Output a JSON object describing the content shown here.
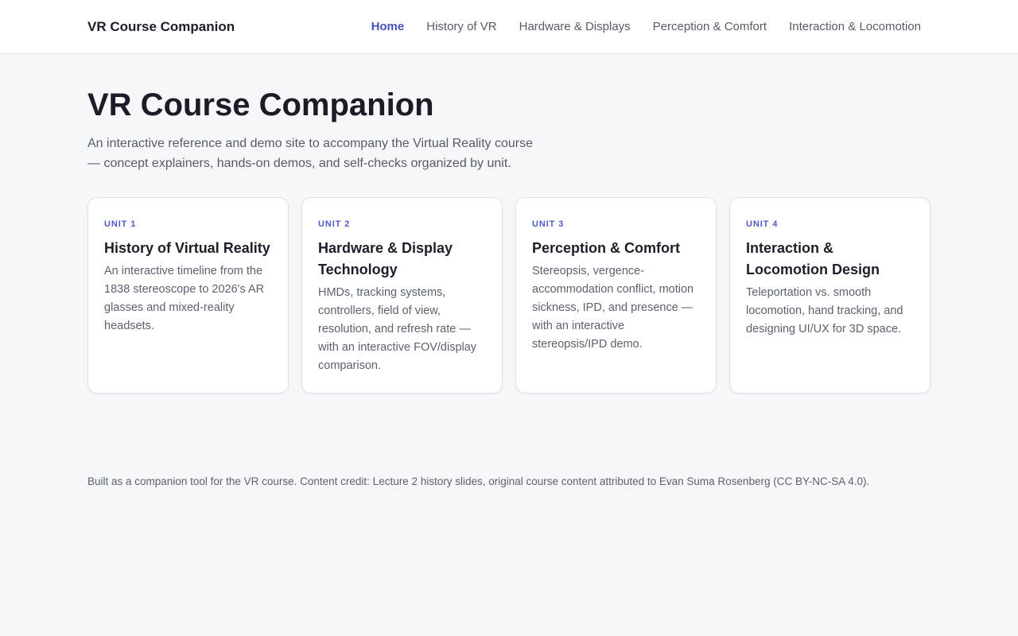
{
  "header": {
    "brand": "VR Course Companion",
    "nav": [
      {
        "label": "Home",
        "active": true
      },
      {
        "label": "History of VR",
        "active": false
      },
      {
        "label": "Hardware & Displays",
        "active": false
      },
      {
        "label": "Perception & Comfort",
        "active": false
      },
      {
        "label": "Interaction & Locomotion",
        "active": false
      }
    ]
  },
  "main": {
    "title": "VR Course Companion",
    "intro": "An interactive reference and demo site to accompany the Virtual Reality course — concept explainers, hands-on demos, and self-checks organized by unit.",
    "cards": [
      {
        "unit": "UNIT 1",
        "title": "History of Virtual Reality",
        "description": "An interactive timeline from the 1838 stereoscope to 2026's AR glasses and mixed-reality headsets."
      },
      {
        "unit": "UNIT 2",
        "title": "Hardware & Display Technology",
        "description": "HMDs, tracking systems, controllers, field of view, resolution, and refresh rate — with an interactive FOV/display comparison."
      },
      {
        "unit": "UNIT 3",
        "title": "Perception & Comfort",
        "description": "Stereopsis, vergence-accommodation conflict, motion sickness, IPD, and presence — with an interactive stereopsis/IPD demo."
      },
      {
        "unit": "UNIT 4",
        "title": "Interaction & Locomotion Design",
        "description": "Teleportation vs. smooth locomotion, hand tracking, and designing UI/UX for 3D space."
      }
    ]
  },
  "footer": {
    "text": "Built as a companion tool for the VR course. Content credit: Lecture 2 history slides, original course content attributed to Evan Suma Rosenberg (CC BY-NC-SA 4.0)."
  },
  "colors": {
    "accent": "#4650c1",
    "background": "#f6f7f9",
    "card_border": "#dfe2e8"
  }
}
